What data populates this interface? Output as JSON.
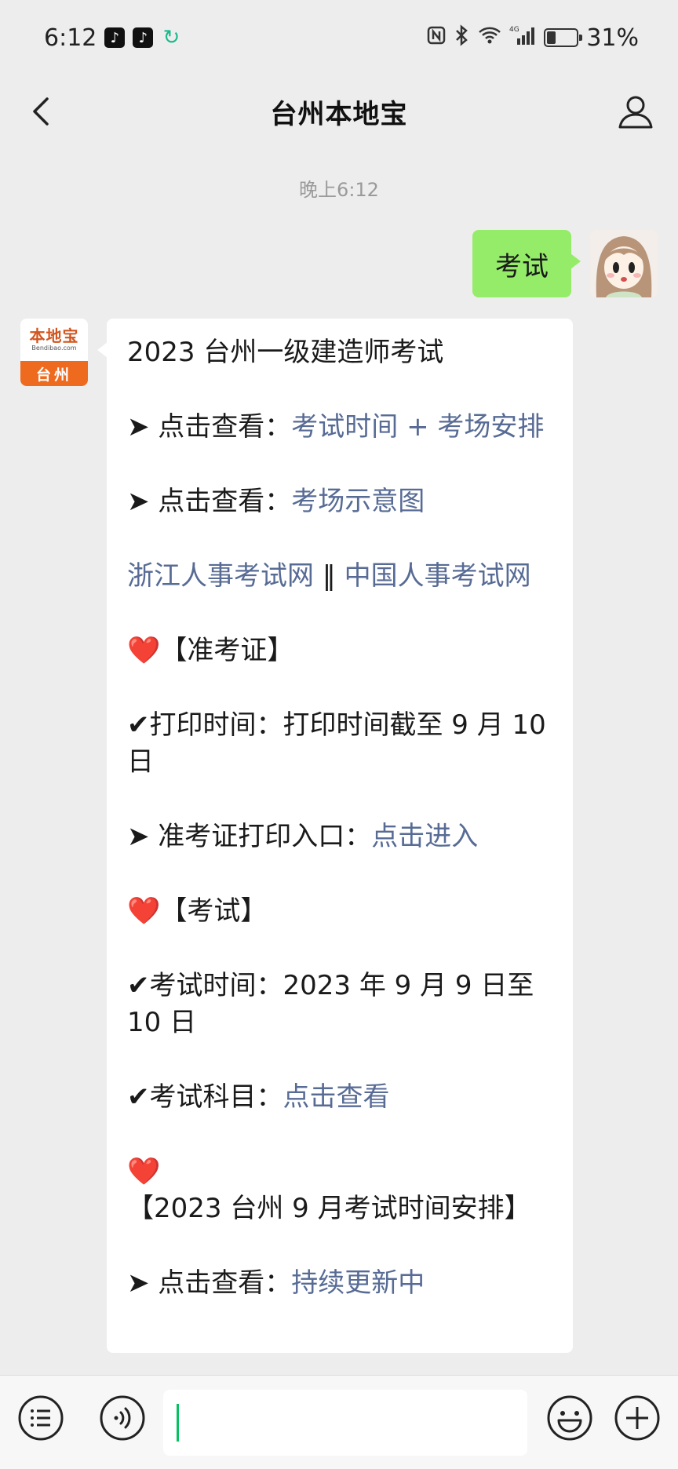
{
  "status_bar": {
    "time": "6:12",
    "battery": "31%",
    "battery_level": 0.31,
    "network": "4G"
  },
  "nav": {
    "title": "台州本地宝"
  },
  "chat": {
    "timestamp": "晚上6:12",
    "outgoing": {
      "text": "考试"
    },
    "bot_avatar": {
      "line1": "本地宝",
      "line2": "Bendibao.com",
      "city": "台州"
    },
    "incoming": {
      "title": "2023 台州一级建造师考试",
      "p1": {
        "prefix": "➤ 点击查看：",
        "link": "考试时间 + 考场安排"
      },
      "p2": {
        "prefix": "➤ 点击查看：",
        "link": "考场示意图"
      },
      "p3": {
        "link1": "浙江人事考试网",
        "sep": " ‖ ",
        "link2": "中国人事考试网"
      },
      "p4": {
        "heart": "❤️",
        "text": "【准考证】"
      },
      "p5": {
        "text": "✔打印时间：打印时间截至 9 月 10 日"
      },
      "p6": {
        "prefix": "➤ 准考证打印入口：",
        "link": "点击进入"
      },
      "p7": {
        "heart": "❤️",
        "text": "【考试】"
      },
      "p8": {
        "text": "✔考试时间：2023 年 9 月 9 日至 10 日"
      },
      "p9": {
        "prefix": "✔考试科目：",
        "link": "点击查看"
      },
      "p10": {
        "heart": "❤️",
        "text": "【2023 台州 9 月考试时间安排】"
      },
      "p11": {
        "prefix": "➤ 点击查看：",
        "link": "持续更新中"
      }
    }
  },
  "input_bar": {
    "placeholder": ""
  },
  "colors": {
    "outgoing_bubble": "#95ec69",
    "link": "#576b95",
    "caret": "#07c160",
    "background": "#ededed"
  }
}
